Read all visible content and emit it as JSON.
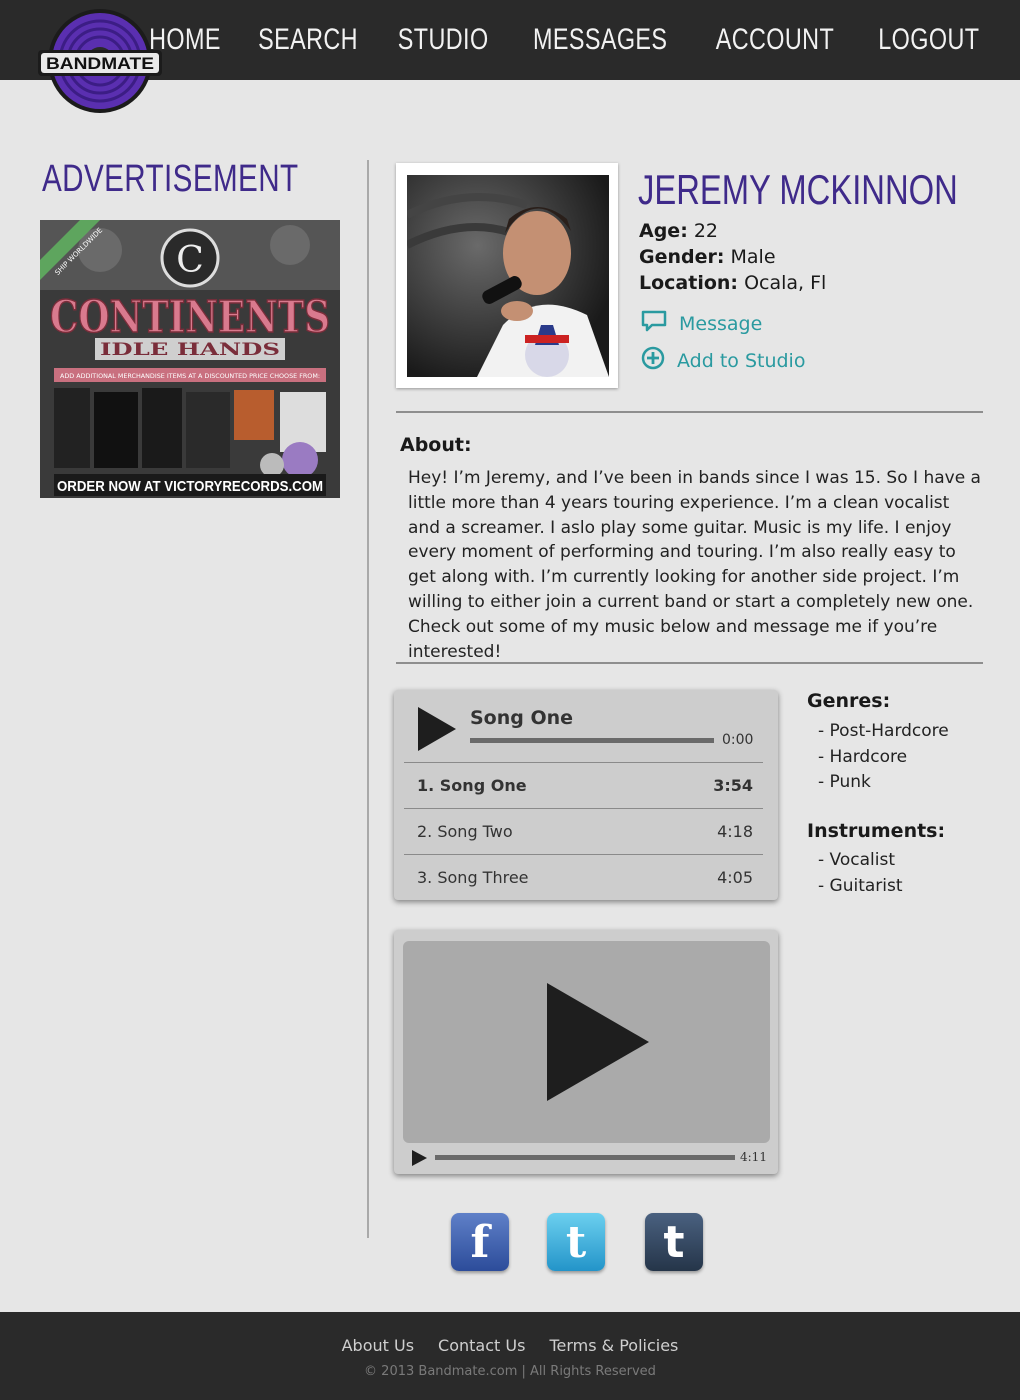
{
  "brand": {
    "logo_text": "BANDMATE"
  },
  "nav": {
    "items": [
      "HOME",
      "SEARCH",
      "STUDIO",
      "MESSAGES",
      "ACCOUNT",
      "LOGOUT"
    ]
  },
  "sidebar": {
    "ad_title": "ADVERTISEMENT",
    "ad": {
      "band": "CONTINENTS",
      "album": "IDLE HANDS",
      "tagline": "ADD ADDITIONAL MERCHANDISE ITEMS AT A DISCOUNTED PRICE CHOOSE FROM:",
      "ship": "SHIP WORLDWIDE",
      "cta": "ORDER NOW AT VICTORYRECORDS.COM"
    }
  },
  "profile": {
    "name": "JEREMY MCKINNON",
    "age_label": "Age:",
    "age": "22",
    "gender_label": "Gender:",
    "gender": "Male",
    "location_label": "Location:",
    "location": "Ocala, Fl",
    "message_label": "Message",
    "add_label": "Add to Studio",
    "about_label": "About:",
    "about": "Hey! I’m Jeremy, and I’ve been in bands since I was 15. So I have a little more than 4 years touring experience. I’m a clean vocalist and a screamer. I aslo play some guitar. Music is my life. I enjoy every moment of performing and touring. I’m also really easy to get along with. I’m currently looking for another side project. I’m willing to either join a current band or start a completely new one. Check out some of my music below and message me if you’re interested!"
  },
  "player": {
    "now_playing": "Song One",
    "elapsed": "0:00",
    "tracks": [
      {
        "title": "1. Song One",
        "duration": "3:54"
      },
      {
        "title": "2. Song Two",
        "duration": "4:18"
      },
      {
        "title": "3. Song Three",
        "duration": "4:05"
      }
    ]
  },
  "video": {
    "duration": "4:11"
  },
  "genres": {
    "label": "Genres:",
    "items": [
      "- Post-Hardcore",
      "- Hardcore",
      "- Punk"
    ]
  },
  "instruments": {
    "label": "Instruments:",
    "items": [
      "- Vocalist",
      "- Guitarist"
    ]
  },
  "social": {
    "facebook": "f",
    "twitter": "t",
    "tumblr": "t"
  },
  "footer": {
    "links": [
      "About Us",
      "Contact Us",
      "Terms & Policies"
    ],
    "copyright": "© 2013 Bandmate.com | All Rights Reserved"
  },
  "colors": {
    "brand_purple": "#3f2a8a",
    "link_teal": "#2a9aa0",
    "header_bg": "#2a2a2a",
    "page_bg": "#e6e6e6"
  }
}
